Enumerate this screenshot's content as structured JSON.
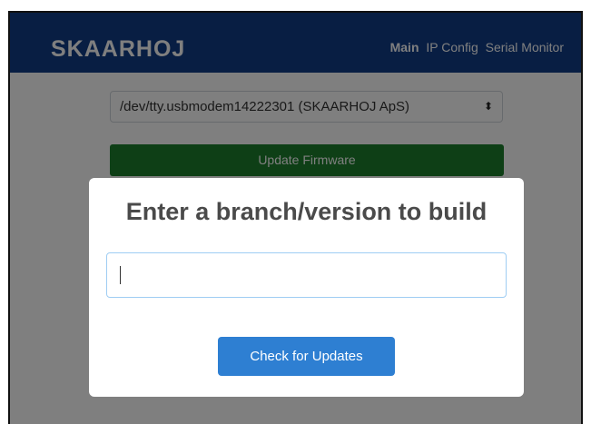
{
  "window": {
    "traffic_lights": [
      "close",
      "minimize",
      "maximize"
    ]
  },
  "header": {
    "logo": "SKAARHOJ",
    "nav": [
      {
        "label": "Main",
        "active": true
      },
      {
        "label": "IP Config",
        "active": false
      },
      {
        "label": "Serial Monitor",
        "active": false
      }
    ]
  },
  "main": {
    "device_select": {
      "value": "/dev/tty.usbmodem14222301 (SKAARHOJ ApS)",
      "arrow": "⬍"
    },
    "update_button": "Update Firmware"
  },
  "modal": {
    "title": "Enter a branch/version to build",
    "input_value": "",
    "check_button": "Check for Updates"
  },
  "colors": {
    "header_bg": "#113d87",
    "update_button_bg": "#1c7f2c",
    "check_button_bg": "#2e7fd2"
  }
}
